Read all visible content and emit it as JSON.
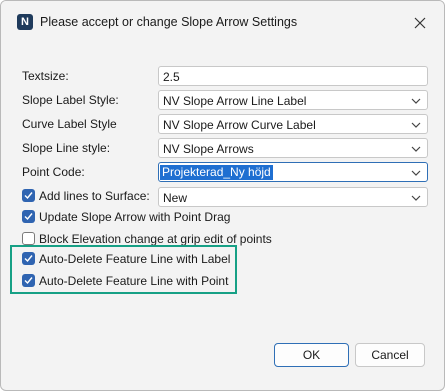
{
  "window": {
    "title": "Please accept or change Slope Arrow Settings",
    "app_icon_letter": "N"
  },
  "fields": {
    "textsize": {
      "label": "Textsize:",
      "value": "2.5"
    },
    "slope_label_style": {
      "label": "Slope Label Style:",
      "value": "NV Slope Arrow Line Label"
    },
    "curve_label_style": {
      "label": "Curve Label Style",
      "value": "NV Slope Arrow Curve Label"
    },
    "slope_line_style": {
      "label": "Slope Line style:",
      "value": "NV Slope Arrows"
    },
    "point_code": {
      "label": "Point Code:",
      "value": "Projekterad_Ny höjd"
    },
    "add_lines": {
      "label": "Add lines to Surface:",
      "value": "New",
      "checked": true
    }
  },
  "checkboxes": [
    {
      "label": "Update Slope Arrow with Point Drag",
      "checked": true
    },
    {
      "label": "Block Elevation change at grip edit of points",
      "checked": false
    },
    {
      "label": "Auto-Delete Feature Line with Label",
      "checked": true
    },
    {
      "label": "Auto-Delete Feature Line with Point",
      "checked": true
    }
  ],
  "buttons": {
    "ok": "OK",
    "cancel": "Cancel"
  },
  "colors": {
    "accent": "#2f64b1",
    "highlight_box": "#16a085",
    "selection": "#1f6fd1"
  }
}
